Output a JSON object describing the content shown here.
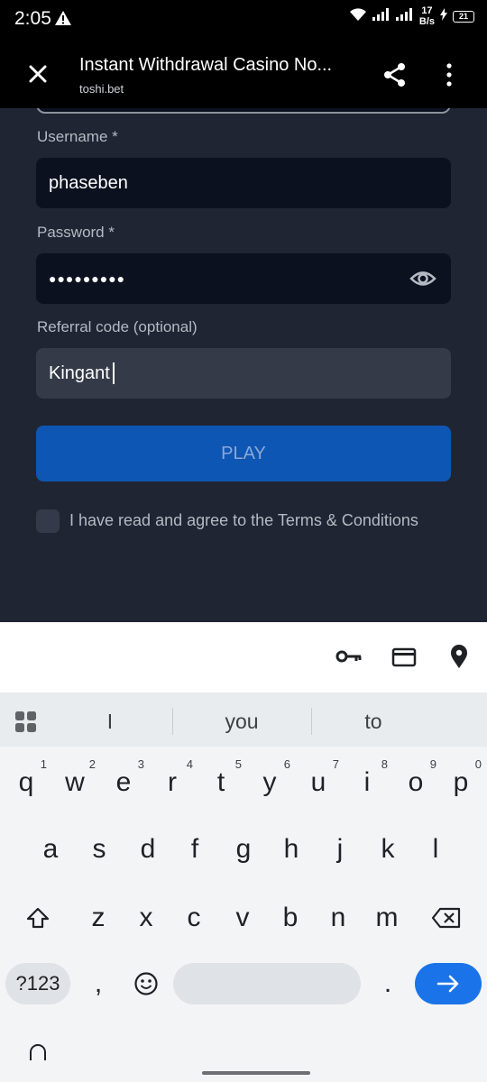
{
  "status_bar": {
    "time": "2:05",
    "net_speed_value": "17",
    "net_speed_unit": "B/s",
    "battery_level": "21"
  },
  "browser": {
    "title": "Instant Withdrawal Casino No...",
    "domain": "toshi.bet"
  },
  "form": {
    "username_label": "Username *",
    "username_value": "phaseben",
    "password_label": "Password *",
    "password_dots": "●●●●●●●●●",
    "referral_label": "Referral code (optional)",
    "referral_value": "Kingant",
    "play_label": "PLAY",
    "terms_text": "I have read and agree to the Terms & Conditions",
    "terms_checked": false
  },
  "colors": {
    "form_bg": "#1f2533",
    "input_bg": "#0c1120",
    "referral_bg": "#343a48",
    "play_button": "#0e56b3",
    "enter_key": "#1a73e8"
  },
  "autofill_bar": {
    "icons": [
      "key-icon",
      "card-icon",
      "location-pin-icon"
    ]
  },
  "keyboard": {
    "suggestions": [
      "I",
      "you",
      "to"
    ],
    "row1": [
      "q",
      "w",
      "e",
      "r",
      "t",
      "y",
      "u",
      "i",
      "o",
      "p"
    ],
    "row1_hints": [
      "1",
      "2",
      "3",
      "4",
      "5",
      "6",
      "7",
      "8",
      "9",
      "0"
    ],
    "row2": [
      "a",
      "s",
      "d",
      "f",
      "g",
      "h",
      "j",
      "k",
      "l"
    ],
    "row3": [
      "z",
      "x",
      "c",
      "v",
      "b",
      "n",
      "m"
    ],
    "symbols_label": "?123",
    "comma": ",",
    "period": "."
  }
}
